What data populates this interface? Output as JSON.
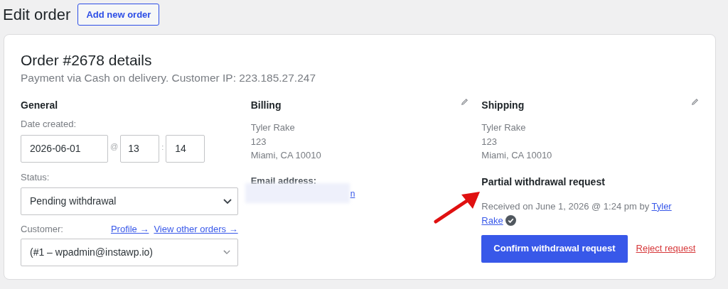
{
  "page_title": "Edit order",
  "add_button": "Add new order",
  "order": {
    "heading": "Order #2678 details",
    "subheading": "Payment via Cash on delivery. Customer IP: 223.185.27.247"
  },
  "general": {
    "heading": "General",
    "date_label": "Date created:",
    "date": "2026-06-01",
    "at": "@",
    "hour": "13",
    "sep": ":",
    "minute": "14",
    "status_label": "Status:",
    "status": "Pending withdrawal",
    "customer_label": "Customer:",
    "links": [
      "Profile →",
      "View other orders →"
    ],
    "customer": "(#1 – wpadmin@instawp.io)"
  },
  "billing": {
    "heading": "Billing",
    "address": [
      "Tyler Rake",
      "123",
      "Miami, CA 10010"
    ],
    "email_label": "Email address:",
    "email_visible": "n"
  },
  "shipping": {
    "heading": "Shipping",
    "address": [
      "Tyler Rake",
      "123",
      "Miami, CA 10010"
    ]
  },
  "withdrawal": {
    "heading": "Partial withdrawal request",
    "received": "Received on June 1, 2026 @ 1:24 pm by",
    "by_link": [
      "Tyler",
      "Rake"
    ],
    "verified": true,
    "confirm": "Confirm withdrawal request",
    "reject": "Reject request"
  }
}
